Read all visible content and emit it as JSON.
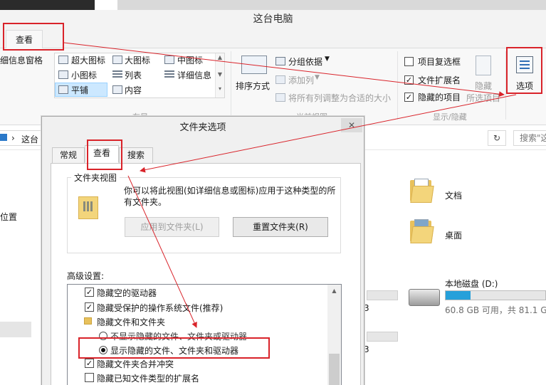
{
  "window": {
    "title": "这台电脑"
  },
  "ribbon": {
    "tab_view": "查看",
    "details_pane": "细信息窗格",
    "layout": {
      "extra_large": "超大图标",
      "large": "大图标",
      "medium": "中图标",
      "small": "小图标",
      "list": "列表",
      "details": "详细信息",
      "tiles": "平铺",
      "content": "内容",
      "group_label": "布局"
    },
    "sort_by": "排序方式",
    "group_by": "分组依据",
    "add_column": "添加列",
    "fit_columns": "将所有列调整为合适的大小",
    "view_group_label": "当前视图",
    "item_checkboxes": "项目复选框",
    "file_extensions": "文件扩展名",
    "hidden_items": "隐藏的项目",
    "hide": "隐藏",
    "hide_selected": "所选项目",
    "show_hide_label": "显示/隐藏",
    "options": "选项",
    "checked": {
      "item_checkboxes": false,
      "file_extensions": true,
      "hidden_items": true
    }
  },
  "address": {
    "text": "这台",
    "search_placeholder": "搜索\"这"
  },
  "nav": {
    "location": "位置"
  },
  "content": {
    "documents": "文档",
    "desktop": "桌面",
    "drive_name": "本地磁盘 (D:)",
    "drive_space": "60.8 GB 可用，共 81.1 GB",
    "drive_used_fraction": 0.25,
    "ghost_digit": "3"
  },
  "dialog": {
    "title": "文件夹选项",
    "close": "✕",
    "tabs": [
      "常规",
      "查看",
      "搜索"
    ],
    "folder_views": {
      "legend": "文件夹视图",
      "description": "你可以将此视图(如详细信息或图标)应用于这种类型的所有文件夹。",
      "apply_btn": "应用到文件夹(L)",
      "reset_btn": "重置文件夹(R)"
    },
    "advanced_label": "高级设置:",
    "advanced": [
      {
        "type": "checkbox",
        "checked": true,
        "label": "隐藏空的驱动器"
      },
      {
        "type": "checkbox",
        "checked": true,
        "label": "隐藏受保护的操作系统文件(推荐)"
      },
      {
        "type": "folder",
        "label": "隐藏文件和文件夹"
      },
      {
        "type": "radio",
        "checked": false,
        "label": "不显示隐藏的文件、文件夹或驱动器"
      },
      {
        "type": "radio",
        "checked": true,
        "label": "显示隐藏的文件、文件夹和驱动器"
      },
      {
        "type": "checkbox",
        "checked": true,
        "label": "隐藏文件夹合并冲突"
      },
      {
        "type": "checkbox",
        "checked": false,
        "label": "隐藏已知文件类型的扩展名"
      }
    ]
  },
  "colors": {
    "highlight": "#d9232a",
    "selection": "#cce8ff",
    "drive_fill": "#26a0da"
  }
}
